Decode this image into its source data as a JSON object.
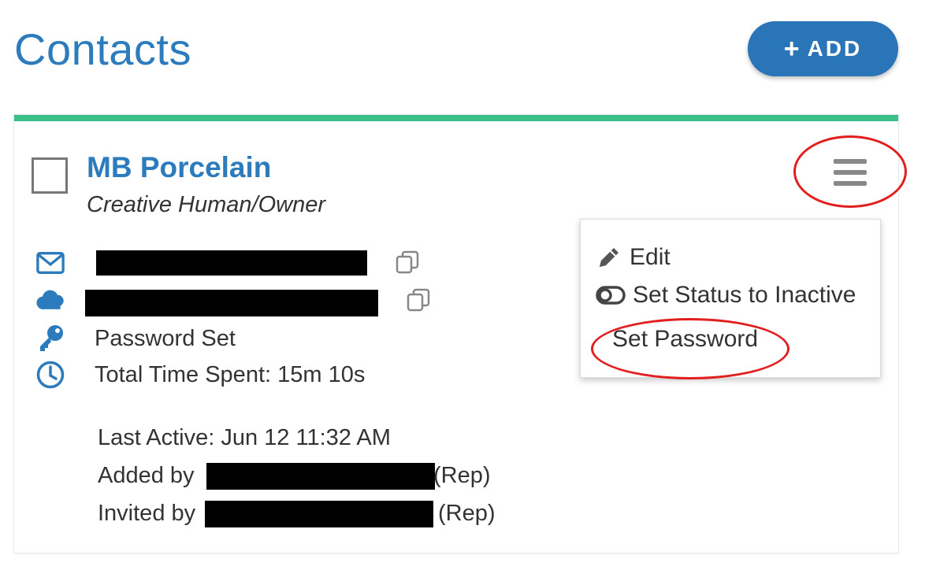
{
  "header": {
    "title": "Contacts",
    "add_plus": "+",
    "add_label": "ADD"
  },
  "contact": {
    "name": "MB Porcelain",
    "role": "Creative Human/Owner",
    "password_status": "Password Set",
    "time_spent": "Total Time Spent: 15m 10s",
    "last_active": "Last Active: Jun 12 11:32 AM",
    "added_by_prefix": "Added by",
    "added_by_suffix": "(Rep)",
    "invited_by_prefix": "Invited by",
    "invited_by_suffix": "(Rep)"
  },
  "menu": {
    "items": [
      {
        "label": "Edit",
        "icon": "pencil-icon"
      },
      {
        "label": "Set Status to Inactive",
        "icon": "toggle-icon"
      },
      {
        "label": "Set Password",
        "icon": ""
      }
    ]
  },
  "icons": {
    "email": "envelope-icon",
    "website": "cloud-icon",
    "password": "key-icon",
    "time": "clock-icon",
    "copy": "copy-icon",
    "menu": "hamburger-icon"
  },
  "colors": {
    "brand_blue": "#2b7bbd",
    "button_blue": "#2a74b8",
    "card_accent": "#3cc08a",
    "annotation_red": "#e21f1f"
  }
}
